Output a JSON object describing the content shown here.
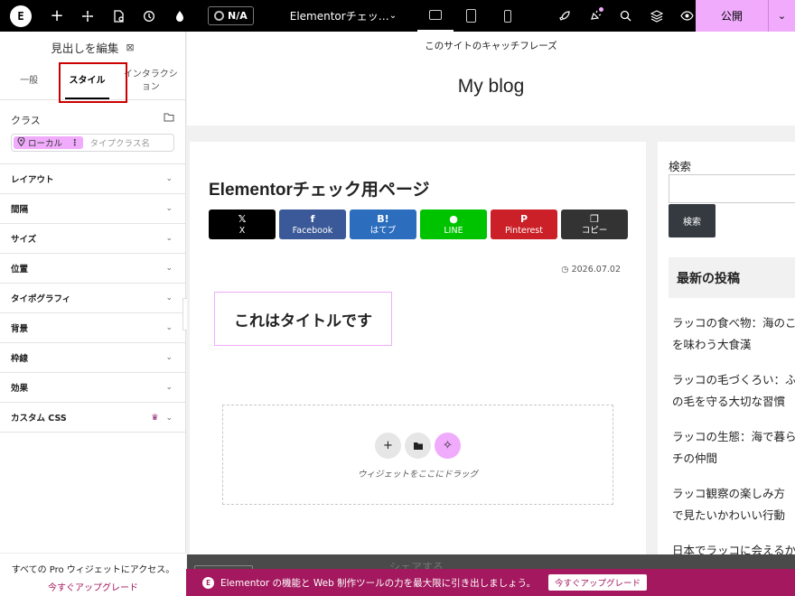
{
  "topbar": {
    "logo_letter": "E",
    "na_label": "N/A",
    "doc_title": "Elementorチェッ…",
    "publish_label": "公開"
  },
  "panel": {
    "title": "見出しを編集",
    "tabs": [
      "一般",
      "スタイル",
      "インタラクション"
    ],
    "active_tab": "スタイル",
    "class_label": "クラス",
    "chip_label": "ローカル",
    "class_placeholder": "タイプクラス名",
    "sections": [
      "レイアウト",
      "間隔",
      "サイズ",
      "位置",
      "タイポグラフィ",
      "背景",
      "枠線",
      "効果",
      "カスタム CSS"
    ],
    "promo_text": "すべての Pro ウィジェットにアクセス。",
    "promo_link": "今すぐアップグレード"
  },
  "canvas": {
    "tagline": "このサイトのキャッチフレーズ",
    "blog_title": "My blog",
    "post_title": "Elementorチェック用ページ",
    "share_buttons": [
      {
        "icon": "𝕏",
        "label": "X",
        "color": "#000000"
      },
      {
        "icon": "f",
        "label": "Facebook",
        "color": "#3b5998"
      },
      {
        "icon": "B!",
        "label": "はてブ",
        "color": "#2c6ebd"
      },
      {
        "icon": "●",
        "label": "LINE",
        "color": "#00c300"
      },
      {
        "icon": "P",
        "label": "Pinterest",
        "color": "#cb2027"
      },
      {
        "icon": "❐",
        "label": "コピー",
        "color": "#333333"
      }
    ],
    "date": "2026.07.02",
    "heading_text": "これはタイトルです",
    "dropzone_text": "ウィジェットをここにドラッグ",
    "share_bar_label": "シェアする"
  },
  "sidebar": {
    "search_label": "検索",
    "search_button": "検索",
    "recent_heading": "最新の投稿",
    "recent_posts": [
      {
        "line1": "ラッコの食べ物：海のこ",
        "line2": "を味わう大食漢"
      },
      {
        "line1": "ラッコの毛づくろい：ふ",
        "line2": "の毛を守る大切な習慣"
      },
      {
        "line1": "ラッコの生態：海で暮ら",
        "line2": "チの仲間"
      },
      {
        "line1": "ラッコ観察の楽しみ方",
        "line2": "で見たいかわいい行動"
      },
      {
        "line1": "日本でラッコに会えるか",
        "line2": ""
      }
    ]
  },
  "upgrade_bar": {
    "message": "Elementor の機能と Web 制作ツールの力を最大限に引き出しましょう。",
    "button": "今すぐアップグレード"
  },
  "colors": {
    "accent_pink": "#f0abfc",
    "brand_magenta": "#a3185e",
    "highlight_red": "#cc0000"
  }
}
